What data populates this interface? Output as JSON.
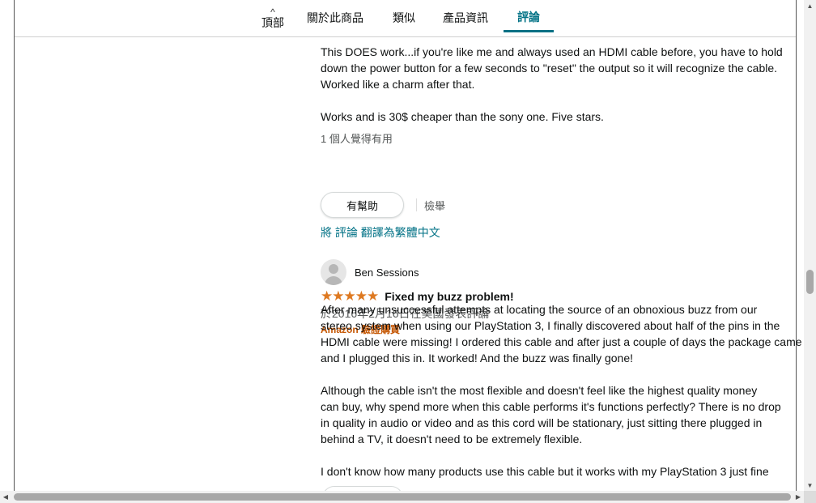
{
  "subnav": {
    "tabs": [
      {
        "label": "頂部"
      },
      {
        "label": "關於此商品"
      },
      {
        "label": "類似"
      },
      {
        "label": "產品資訊"
      },
      {
        "label": "評論"
      }
    ]
  },
  "review1": {
    "body_lines": [
      "This DOES work...if you're like me and always used an HDMI cable before, you have to hold",
      "down the power button for a few seconds to \"reset\" the output so it will recognize the cable.",
      "Worked like a charm after that.",
      "Works and is 30$ cheaper than the sony one. Five stars."
    ],
    "helpful_count": "1 個人覺得有用",
    "helpful_button": "有幫助",
    "report": "檢舉",
    "translate": "將 評論 翻譯為繁體中文"
  },
  "review2": {
    "reviewer": "Ben Sessions",
    "rating": "★★★★★",
    "title": "Fixed my buzz problem!",
    "date": "於2016年2月16日在美國發表評論",
    "verified": "Amazon 驗證購買",
    "body_lines": [
      "After many unsuccessful attempts at locating the source of an obnoxious buzz from our",
      "stereo system when using our PlayStation 3, I finally discovered about half of the pins in the",
      "HDMI cable were missing! I ordered this cable and after just a couple of days the package came",
      "and I plugged this in. It worked! And the buzz was finally gone!",
      "Although the cable isn't the most flexible and doesn't feel like the highest quality money",
      "can buy, why spend more when this cable performs it's functions perfectly? There is no drop",
      "in quality in audio or video and as this cord will be stationary, just sitting there plugged in",
      "behind a TV, it doesn't need to be extremely flexible.",
      "I don't know how many products use this cable but it works with my PlayStation 3 just fine"
    ]
  },
  "colors": {
    "link": "#007185",
    "star": "#de7921",
    "verified": "#c45500"
  },
  "icons": {
    "caret": "^",
    "scroll_up": "▲",
    "scroll_down": "▼",
    "scroll_left": "◀",
    "scroll_right": "▶"
  }
}
